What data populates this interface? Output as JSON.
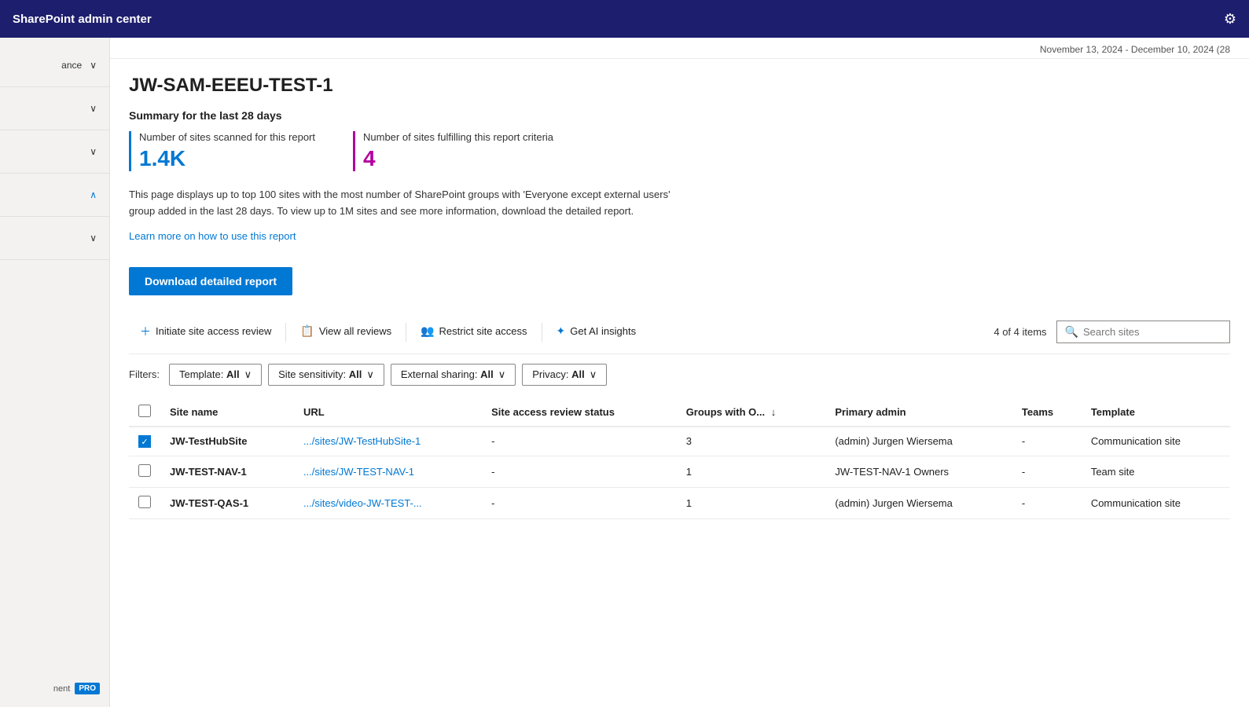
{
  "app": {
    "title": "SharePoint admin center",
    "gear_icon": "⚙"
  },
  "date_range": "November 13, 2024 - December 10, 2024 (28",
  "page": {
    "title": "JW-SAM-EEEU-TEST-1",
    "summary_heading": "Summary for the last 28 days",
    "stat1": {
      "label": "Number of sites scanned for this report",
      "value": "1.4K"
    },
    "stat2": {
      "label": "Number of sites fulfilling this report criteria",
      "value": "4"
    },
    "description": "This page displays up to top 100 sites with the most number of SharePoint groups with 'Everyone except external users' group added in the last 28 days. To view up to 1M sites and see more information, download the detailed report.",
    "learn_more_text": "Learn more on how to use this report",
    "download_btn_label": "Download detailed report"
  },
  "toolbar": {
    "initiate_review_label": "Initiate site access review",
    "view_reviews_label": "View all reviews",
    "restrict_access_label": "Restrict site access",
    "ai_insights_label": "Get AI insights",
    "items_count": "4 of 4 items",
    "search_placeholder": "Search sites"
  },
  "filters": {
    "label": "Filters:",
    "template": {
      "label": "Template:",
      "value": "All"
    },
    "sensitivity": {
      "label": "Site sensitivity:",
      "value": "All"
    },
    "external_sharing": {
      "label": "External sharing:",
      "value": "All"
    },
    "privacy": {
      "label": "Privacy:",
      "value": "All"
    }
  },
  "table": {
    "columns": [
      {
        "id": "site_name",
        "label": "Site name"
      },
      {
        "id": "url",
        "label": "URL"
      },
      {
        "id": "review_status",
        "label": "Site access review status"
      },
      {
        "id": "groups",
        "label": "Groups with O...",
        "sortable": true
      },
      {
        "id": "primary_admin",
        "label": "Primary admin"
      },
      {
        "id": "teams",
        "label": "Teams"
      },
      {
        "id": "template",
        "label": "Template"
      }
    ],
    "rows": [
      {
        "checked": true,
        "site_name": "JW-TestHubSite",
        "url": ".../sites/JW-TestHubSite-1",
        "review_status": "-",
        "groups": "3",
        "primary_admin": "(admin) Jurgen Wiersema",
        "teams": "-",
        "template": "Communication site"
      },
      {
        "checked": false,
        "site_name": "JW-TEST-NAV-1",
        "url": ".../sites/JW-TEST-NAV-1",
        "review_status": "-",
        "groups": "1",
        "primary_admin": "JW-TEST-NAV-1 Owners",
        "teams": "-",
        "template": "Team site"
      },
      {
        "checked": false,
        "site_name": "JW-TEST-QAS-1",
        "url": ".../sites/video-JW-TEST-...",
        "review_status": "-",
        "groups": "1",
        "primary_admin": "(admin) Jurgen Wiersema",
        "teams": "-",
        "template": "Communication site"
      }
    ]
  },
  "sidebar": {
    "items": [
      {
        "label": "ance",
        "chevron": "∨",
        "expanded": false
      },
      {
        "label": "",
        "chevron": "∨",
        "expanded": false
      },
      {
        "label": "",
        "chevron": "∨",
        "expanded": false
      },
      {
        "label": "",
        "chevron": "∧",
        "expanded": true
      },
      {
        "label": "",
        "chevron": "∨",
        "expanded": false
      }
    ],
    "partial_label": "nent",
    "pro_badge": "PRO"
  }
}
